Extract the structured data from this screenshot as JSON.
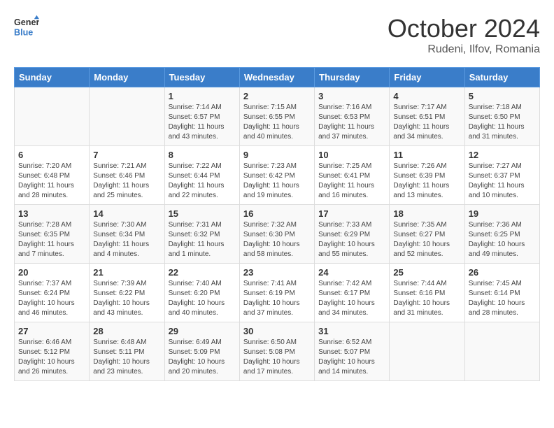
{
  "header": {
    "logo_text_general": "General",
    "logo_text_blue": "Blue",
    "month": "October 2024",
    "location": "Rudeni, Ilfov, Romania"
  },
  "weekdays": [
    "Sunday",
    "Monday",
    "Tuesday",
    "Wednesday",
    "Thursday",
    "Friday",
    "Saturday"
  ],
  "weeks": [
    [
      {
        "day": "",
        "info": ""
      },
      {
        "day": "",
        "info": ""
      },
      {
        "day": "1",
        "info": "Sunrise: 7:14 AM\nSunset: 6:57 PM\nDaylight: 11 hours and 43 minutes."
      },
      {
        "day": "2",
        "info": "Sunrise: 7:15 AM\nSunset: 6:55 PM\nDaylight: 11 hours and 40 minutes."
      },
      {
        "day": "3",
        "info": "Sunrise: 7:16 AM\nSunset: 6:53 PM\nDaylight: 11 hours and 37 minutes."
      },
      {
        "day": "4",
        "info": "Sunrise: 7:17 AM\nSunset: 6:51 PM\nDaylight: 11 hours and 34 minutes."
      },
      {
        "day": "5",
        "info": "Sunrise: 7:18 AM\nSunset: 6:50 PM\nDaylight: 11 hours and 31 minutes."
      }
    ],
    [
      {
        "day": "6",
        "info": "Sunrise: 7:20 AM\nSunset: 6:48 PM\nDaylight: 11 hours and 28 minutes."
      },
      {
        "day": "7",
        "info": "Sunrise: 7:21 AM\nSunset: 6:46 PM\nDaylight: 11 hours and 25 minutes."
      },
      {
        "day": "8",
        "info": "Sunrise: 7:22 AM\nSunset: 6:44 PM\nDaylight: 11 hours and 22 minutes."
      },
      {
        "day": "9",
        "info": "Sunrise: 7:23 AM\nSunset: 6:42 PM\nDaylight: 11 hours and 19 minutes."
      },
      {
        "day": "10",
        "info": "Sunrise: 7:25 AM\nSunset: 6:41 PM\nDaylight: 11 hours and 16 minutes."
      },
      {
        "day": "11",
        "info": "Sunrise: 7:26 AM\nSunset: 6:39 PM\nDaylight: 11 hours and 13 minutes."
      },
      {
        "day": "12",
        "info": "Sunrise: 7:27 AM\nSunset: 6:37 PM\nDaylight: 11 hours and 10 minutes."
      }
    ],
    [
      {
        "day": "13",
        "info": "Sunrise: 7:28 AM\nSunset: 6:35 PM\nDaylight: 11 hours and 7 minutes."
      },
      {
        "day": "14",
        "info": "Sunrise: 7:30 AM\nSunset: 6:34 PM\nDaylight: 11 hours and 4 minutes."
      },
      {
        "day": "15",
        "info": "Sunrise: 7:31 AM\nSunset: 6:32 PM\nDaylight: 11 hours and 1 minute."
      },
      {
        "day": "16",
        "info": "Sunrise: 7:32 AM\nSunset: 6:30 PM\nDaylight: 10 hours and 58 minutes."
      },
      {
        "day": "17",
        "info": "Sunrise: 7:33 AM\nSunset: 6:29 PM\nDaylight: 10 hours and 55 minutes."
      },
      {
        "day": "18",
        "info": "Sunrise: 7:35 AM\nSunset: 6:27 PM\nDaylight: 10 hours and 52 minutes."
      },
      {
        "day": "19",
        "info": "Sunrise: 7:36 AM\nSunset: 6:25 PM\nDaylight: 10 hours and 49 minutes."
      }
    ],
    [
      {
        "day": "20",
        "info": "Sunrise: 7:37 AM\nSunset: 6:24 PM\nDaylight: 10 hours and 46 minutes."
      },
      {
        "day": "21",
        "info": "Sunrise: 7:39 AM\nSunset: 6:22 PM\nDaylight: 10 hours and 43 minutes."
      },
      {
        "day": "22",
        "info": "Sunrise: 7:40 AM\nSunset: 6:20 PM\nDaylight: 10 hours and 40 minutes."
      },
      {
        "day": "23",
        "info": "Sunrise: 7:41 AM\nSunset: 6:19 PM\nDaylight: 10 hours and 37 minutes."
      },
      {
        "day": "24",
        "info": "Sunrise: 7:42 AM\nSunset: 6:17 PM\nDaylight: 10 hours and 34 minutes."
      },
      {
        "day": "25",
        "info": "Sunrise: 7:44 AM\nSunset: 6:16 PM\nDaylight: 10 hours and 31 minutes."
      },
      {
        "day": "26",
        "info": "Sunrise: 7:45 AM\nSunset: 6:14 PM\nDaylight: 10 hours and 28 minutes."
      }
    ],
    [
      {
        "day": "27",
        "info": "Sunrise: 6:46 AM\nSunset: 5:12 PM\nDaylight: 10 hours and 26 minutes."
      },
      {
        "day": "28",
        "info": "Sunrise: 6:48 AM\nSunset: 5:11 PM\nDaylight: 10 hours and 23 minutes."
      },
      {
        "day": "29",
        "info": "Sunrise: 6:49 AM\nSunset: 5:09 PM\nDaylight: 10 hours and 20 minutes."
      },
      {
        "day": "30",
        "info": "Sunrise: 6:50 AM\nSunset: 5:08 PM\nDaylight: 10 hours and 17 minutes."
      },
      {
        "day": "31",
        "info": "Sunrise: 6:52 AM\nSunset: 5:07 PM\nDaylight: 10 hours and 14 minutes."
      },
      {
        "day": "",
        "info": ""
      },
      {
        "day": "",
        "info": ""
      }
    ]
  ]
}
